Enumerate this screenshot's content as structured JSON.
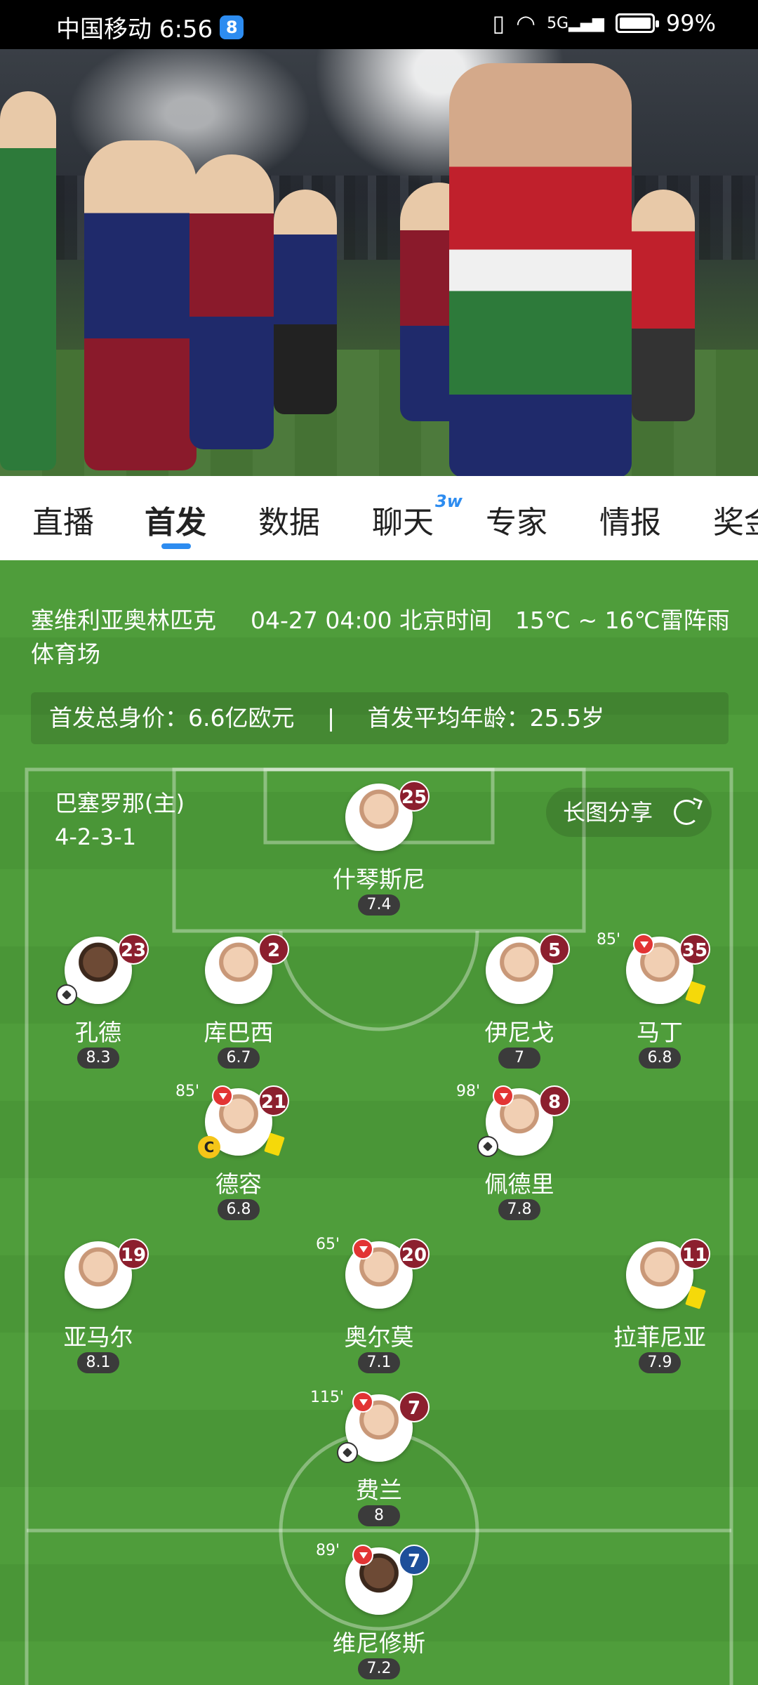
{
  "status_bar": {
    "carrier_time": "中国移动 6:56",
    "app_badge": "8",
    "network": "5G",
    "battery": "99%"
  },
  "tabs": [
    {
      "label": "直播"
    },
    {
      "label": "首发",
      "active": true
    },
    {
      "label": "数据"
    },
    {
      "label": "聊天",
      "superscript": "3w"
    },
    {
      "label": "专家"
    },
    {
      "label": "情报"
    },
    {
      "label": "奖金"
    }
  ],
  "match_info": {
    "venue_line1": "塞维利亚奥林匹克",
    "venue_line2": "体育场",
    "datetime": "04-27 04:00 北京时间",
    "weather": "15℃ ~ 16℃雷阵雨"
  },
  "summary": {
    "value": "首发总身价：6.6亿欧元",
    "separator": "|",
    "age": "首发平均年龄：25.5岁"
  },
  "team": {
    "name": "巴塞罗那(主)",
    "formation": "4-2-3-1",
    "share_label": "长图分享"
  },
  "players": [
    {
      "name": "什琴斯尼",
      "number": "25",
      "rating": "7.4"
    },
    {
      "name": "孔德",
      "number": "23",
      "rating": "8.3",
      "event": "ball"
    },
    {
      "name": "库巴西",
      "number": "2",
      "rating": "6.7"
    },
    {
      "name": "伊尼戈",
      "number": "5",
      "rating": "7"
    },
    {
      "name": "马丁",
      "number": "35",
      "rating": "6.8",
      "sub_time": "85'",
      "yellow": true
    },
    {
      "name": "德容",
      "number": "21",
      "rating": "6.8",
      "sub_time": "85'",
      "captain": "C",
      "yellow": true
    },
    {
      "name": "佩德里",
      "number": "8",
      "rating": "7.8",
      "sub_time": "98'",
      "event": "ball"
    },
    {
      "name": "亚马尔",
      "number": "19",
      "rating": "8.1"
    },
    {
      "name": "奥尔莫",
      "number": "20",
      "rating": "7.1",
      "sub_time": "65'"
    },
    {
      "name": "拉菲尼亚",
      "number": "11",
      "rating": "7.9",
      "yellow": true
    },
    {
      "name": "费兰",
      "number": "7",
      "rating": "8",
      "sub_time": "115'",
      "event": "ball"
    },
    {
      "name": "维尼修斯",
      "number": "7",
      "rating": "7.2",
      "sub_time": "89'",
      "opponent": true
    }
  ],
  "colors": {
    "accent": "#2d8cf0",
    "home_badge": "#8c1f2e",
    "away_badge": "#1e4f9a",
    "pitch": "#4f9d3b"
  }
}
